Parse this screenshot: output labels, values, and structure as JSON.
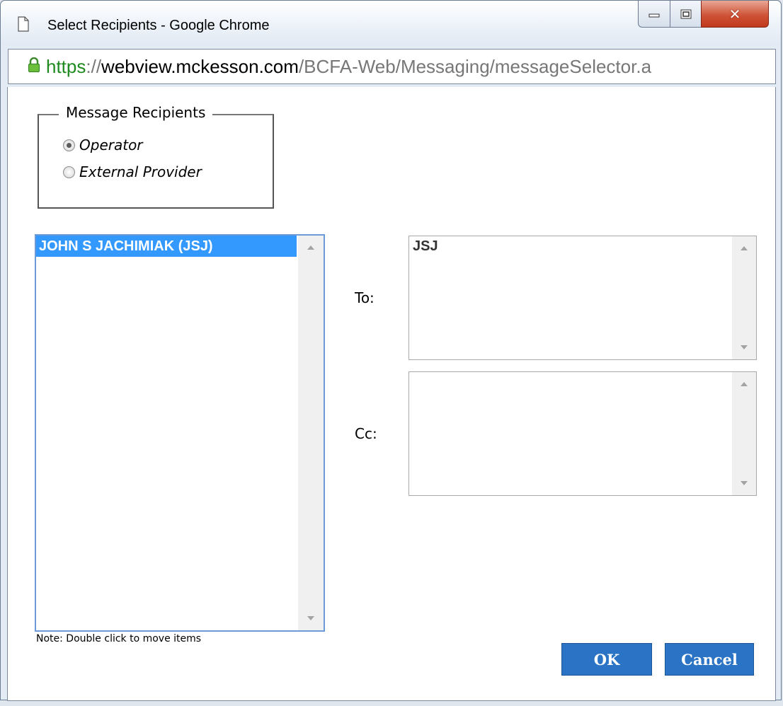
{
  "window": {
    "title": "Select Recipients - Google Chrome"
  },
  "address_bar": {
    "scheme": "https",
    "separator": "://",
    "host": "webview.mckesson.com",
    "path": "/BCFA-Web/Messaging/messageSelector.a"
  },
  "recipients_group": {
    "legend": "Message Recipients",
    "options": [
      {
        "label": "Operator",
        "selected": true
      },
      {
        "label": "External Provider",
        "selected": false
      }
    ]
  },
  "available_list": {
    "items": [
      {
        "label": "JOHN S JACHIMIAK (JSJ)",
        "selected": true
      }
    ]
  },
  "note": "Note: Double click to move items",
  "to_field": {
    "label": "To:",
    "value": "JSJ"
  },
  "cc_field": {
    "label": "Cc:",
    "value": ""
  },
  "buttons": {
    "ok": "OK",
    "cancel": "Cancel"
  }
}
